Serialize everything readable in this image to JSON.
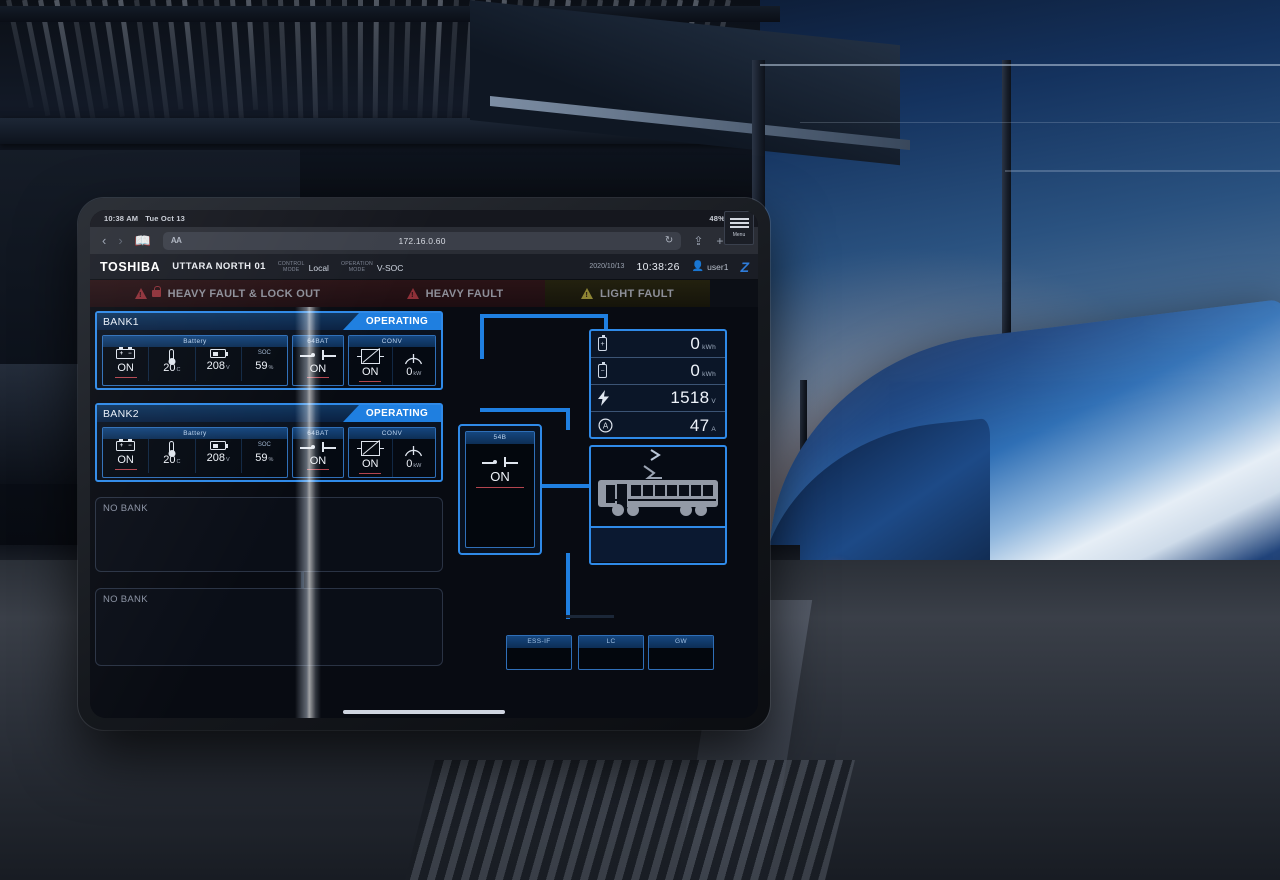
{
  "status_bar": {
    "time": "10:38 AM",
    "date": "Tue Oct 13",
    "battery_percent": "48%",
    "battery_icon": "battery-icon"
  },
  "browser": {
    "back_icon": "chevron-left-icon",
    "forward_icon": "chevron-right-icon",
    "bookmarks_icon": "book-icon",
    "text_size_label": "AA",
    "url": "172.16.0.60",
    "reload_icon": "reload-icon",
    "share_icon": "share-icon",
    "new_tab_icon": "plus-icon",
    "tabs_icon": "tabs-icon"
  },
  "header": {
    "brand": "TOSHIBA",
    "site_name": "UTTARA NORTH 01",
    "control_mode_label_line1": "CONTROL",
    "control_mode_label_line2": "MODE",
    "control_mode_value": "Local",
    "operation_mode_label_line1": "OPERATION",
    "operation_mode_label_line2": "MODE",
    "operation_mode_value": "V-SOC",
    "date": "2020/10/13",
    "time": "10:38:26",
    "user_icon": "user-icon",
    "user_name": "user1",
    "vendor_mark": "Z"
  },
  "alarms": [
    {
      "name": "heavy-fault-lock-out",
      "label": "HEAVY FAULT & LOCK OUT",
      "icons": [
        "warning-triangle-icon",
        "lock-icon"
      ],
      "severity": "heavy",
      "color": "#8e3038"
    },
    {
      "name": "heavy-fault",
      "label": "HEAVY FAULT",
      "icons": [
        "warning-triangle-icon"
      ],
      "severity": "heavy",
      "color": "#8e3038"
    },
    {
      "name": "light-fault",
      "label": "LIGHT FAULT",
      "icons": [
        "warning-triangle-icon"
      ],
      "severity": "light",
      "color": "#8e8534"
    }
  ],
  "menu_button": {
    "label": "Menu",
    "icon": "hamburger-icon"
  },
  "banks": [
    {
      "title": "BANK1",
      "status": "OPERATING",
      "battery": {
        "header": "Battery",
        "fields": [
          {
            "name": "battery-switch",
            "icon": "battery-terminal-icon",
            "value": "ON",
            "unit": ""
          },
          {
            "name": "battery-temperature",
            "icon": "thermometer-icon",
            "value": "20",
            "unit": "C"
          },
          {
            "name": "battery-voltage",
            "icon": "battery-level-icon",
            "value": "208",
            "unit": "V"
          },
          {
            "name": "battery-soc",
            "icon": "",
            "header": "SOC",
            "value": "59",
            "unit": "%"
          }
        ]
      },
      "bat_breaker": {
        "header": "64BAT",
        "icon": "breaker-icon",
        "value": "ON"
      },
      "conv": {
        "header": "CONV",
        "state": "ON",
        "state_icon": "converter-icon",
        "power_value": "0",
        "power_unit": "kW",
        "gauge_icon": "gauge-icon"
      }
    },
    {
      "title": "BANK2",
      "status": "OPERATING",
      "battery": {
        "header": "Battery",
        "fields": [
          {
            "name": "battery-switch",
            "icon": "battery-terminal-icon",
            "value": "ON",
            "unit": ""
          },
          {
            "name": "battery-temperature",
            "icon": "thermometer-icon",
            "value": "20",
            "unit": "C"
          },
          {
            "name": "battery-voltage",
            "icon": "battery-level-icon",
            "value": "208",
            "unit": "V"
          },
          {
            "name": "battery-soc",
            "icon": "",
            "header": "SOC",
            "value": "59",
            "unit": "%"
          }
        ]
      },
      "bat_breaker": {
        "header": "64BAT",
        "icon": "breaker-icon",
        "value": "ON"
      },
      "conv": {
        "header": "CONV",
        "state": "ON",
        "state_icon": "converter-icon",
        "power_value": "0",
        "power_unit": "kW",
        "gauge_icon": "gauge-icon"
      }
    }
  ],
  "empty_banks": [
    {
      "label": "NO BANK"
    },
    {
      "label": "NO BANK"
    }
  ],
  "main_breaker": {
    "header": "54B",
    "icon": "breaker-icon",
    "value": "ON"
  },
  "metrics": [
    {
      "name": "charge-energy",
      "icon": "battery-plus-icon",
      "symbol": "+",
      "value": "0",
      "unit": "kWh"
    },
    {
      "name": "discharge-energy",
      "icon": "battery-minus-icon",
      "symbol": "−",
      "value": "0",
      "unit": "kWh"
    },
    {
      "name": "line-voltage",
      "icon": "bolt-icon",
      "value": "1518",
      "unit": "V"
    },
    {
      "name": "line-current",
      "icon": "ammeter-icon",
      "value": "47",
      "unit": "A"
    }
  ],
  "train_panel": {
    "icon": "train-icon",
    "flow_icon": "flow-arrow-icon"
  },
  "bottom_buttons": [
    {
      "label": "ESS-IF"
    },
    {
      "label": "LC"
    },
    {
      "label": "GW"
    }
  ],
  "colors": {
    "accent_blue": "#1f7fe0",
    "panel_border": "#2f8ae8",
    "heavy_fault": "#8e3038",
    "light_fault": "#8e8534",
    "screen_bg": "#080b12"
  }
}
